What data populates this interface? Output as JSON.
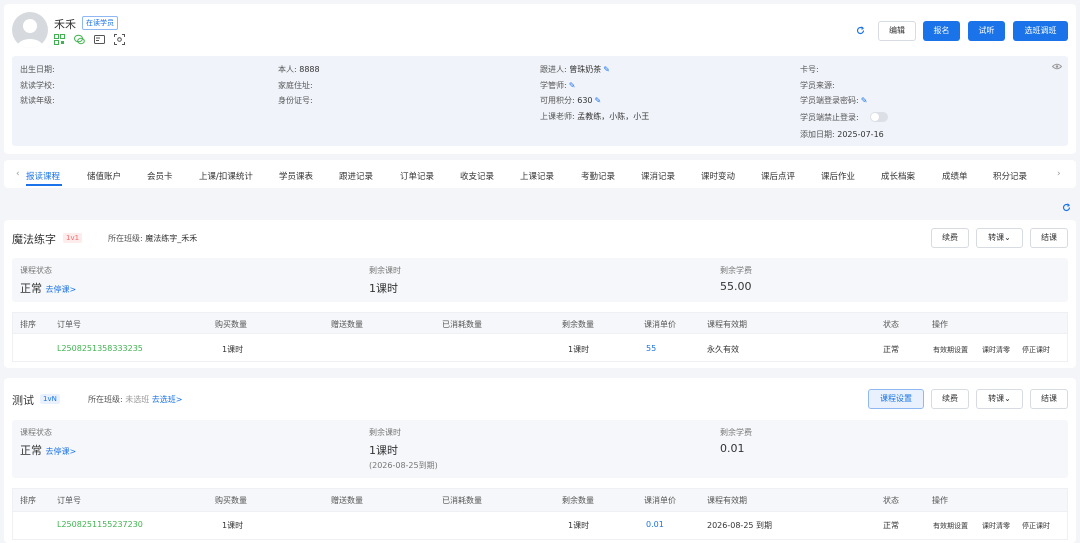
{
  "student": {
    "name": "禾禾",
    "status_badge": "在读学员",
    "actions": {
      "refresh": "",
      "edit": "编辑",
      "enroll": "报名",
      "trial": "试听",
      "transfer": "选班调班"
    }
  },
  "info": {
    "birth_label": "出生日期:",
    "school_label": "就读学校:",
    "grade_label": "就读年级:",
    "self_label": "本人:",
    "self_value": "8888",
    "address_label": "家庭住址:",
    "idcard_label": "身份证号:",
    "follower_label": "跟进人:",
    "follower_value": "曾珠奶茶",
    "manager_label": "学管师:",
    "points_label": "可用积分:",
    "points_value": "630",
    "teacher_label": "上课老师:",
    "teacher_value": "孟教练，小陈，小王",
    "card_label": "卡号:",
    "source_label": "学员来源:",
    "login_pwd_label": "学员端登录密码:",
    "login_ban_label": "学员端禁止登录:",
    "added_label": "添加日期:",
    "added_value": "2025-07-16"
  },
  "tabs": [
    "报读课程",
    "储值账户",
    "会员卡",
    "上课/扣课统计",
    "学员课表",
    "跟进记录",
    "订单记录",
    "收支记录",
    "上课记录",
    "考勤记录",
    "课消记录",
    "课时变动",
    "课后点评",
    "课后作业",
    "成长档案",
    "成绩单",
    "积分记录"
  ],
  "course1": {
    "name": "魔法练字",
    "tag": "1v1",
    "class_label": "所在班级:",
    "class_value": "魔法练字_禾禾",
    "btn_renew": "续费",
    "btn_transfer": "转课",
    "btn_finish": "结课",
    "status_label": "课程状态",
    "status_value": "正常",
    "status_link": "去停课>",
    "remain_label": "剩余课时",
    "remain_value": "1课时",
    "fee_label": "剩余学费",
    "fee_value": "55.00",
    "headers": [
      "排序",
      "订单号",
      "购买数量",
      "赠送数量",
      "已消耗数量",
      "剩余数量",
      "课消单价",
      "课程有效期",
      "状态",
      "操作"
    ],
    "row": {
      "order": "L2508251358333235",
      "buy": "1课时",
      "remain": "1课时",
      "price": "55",
      "valid": "永久有效",
      "state": "正常",
      "op1": "有效期设置",
      "op2": "课时清零",
      "op3": "停正课时"
    }
  },
  "course2": {
    "name": "测试",
    "tag": "1vN",
    "class_label": "所在班级:",
    "class_value": "未选班",
    "class_link": "去选班>",
    "btn_setting": "课程设置",
    "btn_renew": "续费",
    "btn_transfer": "转课",
    "btn_finish": "结课",
    "status_label": "课程状态",
    "status_value": "正常",
    "status_link": "去停课>",
    "remain_label": "剩余课时",
    "remain_value": "1课时",
    "remain_sub": "(2026-08-25到期)",
    "fee_label": "剩余学费",
    "fee_value": "0.01",
    "headers": [
      "排序",
      "订单号",
      "购买数量",
      "赠送数量",
      "已消耗数量",
      "剩余数量",
      "课消单价",
      "课程有效期",
      "状态",
      "操作"
    ],
    "row": {
      "order": "L2508251155237230",
      "buy": "1课时",
      "remain": "1课时",
      "price": "0.01",
      "valid": "2026-08-25 到期",
      "state": "正常",
      "op1": "有效期设置",
      "op2": "课时清零",
      "op3": "停正课时"
    }
  },
  "colors": {
    "accent": "#1a73e8",
    "green": "#3fb34f",
    "tag_red": "#f56c6c"
  }
}
